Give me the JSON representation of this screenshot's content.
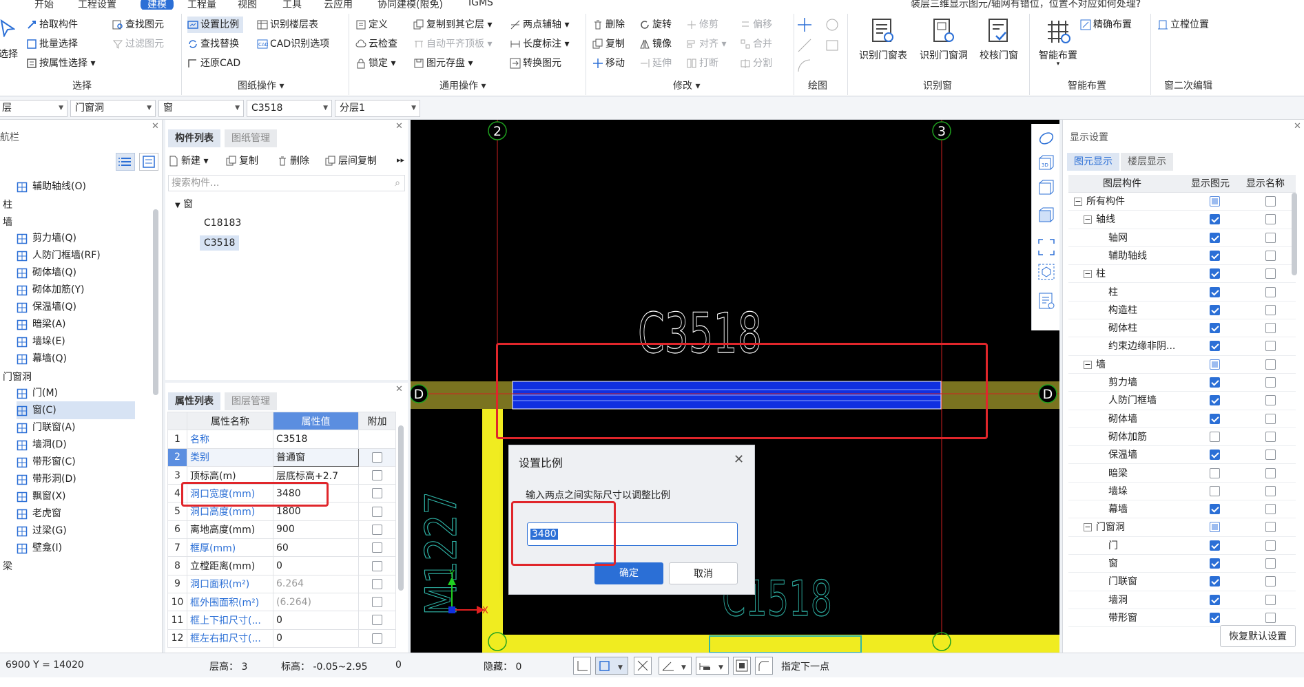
{
  "menu": {
    "items": [
      "开始",
      "工程设置",
      "建模",
      "工程量",
      "视图",
      "工具",
      "云应用",
      "协同建模(限免)",
      "IGMS"
    ],
    "active_index": 2,
    "hint": "装层三维显示图元/轴网有错位，位置不对应如何处理?"
  },
  "ribbon": {
    "select_group": {
      "big": "选择",
      "items": [
        "拾取构件",
        "批量选择",
        "按属性选择",
        "查找图元",
        "过滤图元"
      ],
      "title": "选择"
    },
    "drawing_ops": {
      "items": [
        "设置比例",
        "识别楼层表",
        "查找替换",
        "CAD识别选项",
        "还原CAD"
      ],
      "title": "图纸操作"
    },
    "common_ops": {
      "items": [
        "定义",
        "复制到其它层",
        "两点辅轴",
        "云检查",
        "自动平齐顶板",
        "长度标注",
        "锁定",
        "图元存盘",
        "转换图元"
      ],
      "title": "通用操作"
    },
    "modify": {
      "items": [
        "删除",
        "旋转",
        "修剪",
        "偏移",
        "复制",
        "镜像",
        "对齐",
        "合并",
        "移动",
        "延伸",
        "打断",
        "分割"
      ],
      "title": "修改"
    },
    "draw": {
      "title": "绘图"
    },
    "recognize": {
      "items": [
        "识别门窗表",
        "识别门窗洞",
        "校核门窗"
      ],
      "title": "识别窗"
    },
    "smart": {
      "items": [
        "智能布置",
        "精确布置"
      ],
      "title": "智能布置"
    },
    "window_edit": {
      "items": [
        "立樘位置"
      ],
      "title": "窗二次编辑"
    }
  },
  "selectors": [
    "层",
    "门窗洞",
    "窗",
    "C3518",
    "分层1"
  ],
  "nav": {
    "title": "航栏",
    "items": [
      {
        "type": "item",
        "label": "辅助轴线(O)",
        "icon": "grid-icon"
      },
      {
        "type": "cat",
        "label": "柱"
      },
      {
        "type": "cat",
        "label": "墙"
      },
      {
        "type": "item",
        "label": "剪力墙(Q)",
        "icon": "wall-icon"
      },
      {
        "type": "item",
        "label": "人防门框墙(RF)",
        "icon": "wall-icon"
      },
      {
        "type": "item",
        "label": "砌体墙(Q)",
        "icon": "brick-icon"
      },
      {
        "type": "item",
        "label": "砌体加筋(Y)",
        "icon": "rebar-icon"
      },
      {
        "type": "item",
        "label": "保温墙(Q)",
        "icon": "insulation-icon"
      },
      {
        "type": "item",
        "label": "暗梁(A)",
        "icon": "beam-icon"
      },
      {
        "type": "item",
        "label": "墙垛(E)",
        "icon": "pier-icon"
      },
      {
        "type": "item",
        "label": "幕墙(Q)",
        "icon": "curtain-icon"
      },
      {
        "type": "cat",
        "label": "门窗洞"
      },
      {
        "type": "item",
        "label": "门(M)",
        "icon": "door-icon"
      },
      {
        "type": "item",
        "label": "窗(C)",
        "icon": "window-icon",
        "selected": true
      },
      {
        "type": "item",
        "label": "门联窗(A)",
        "icon": "door-window-icon"
      },
      {
        "type": "item",
        "label": "墙洞(D)",
        "icon": "hole-icon"
      },
      {
        "type": "item",
        "label": "带形窗(C)",
        "icon": "strip-window-icon"
      },
      {
        "type": "item",
        "label": "带形洞(D)",
        "icon": "strip-hole-icon"
      },
      {
        "type": "item",
        "label": "飘窗(X)",
        "icon": "bay-window-icon"
      },
      {
        "type": "item",
        "label": "老虎窗",
        "icon": "dormer-icon"
      },
      {
        "type": "item",
        "label": "过梁(G)",
        "icon": "lintel-icon"
      },
      {
        "type": "item",
        "label": "壁龛(I)",
        "icon": "niche-icon"
      },
      {
        "type": "cat",
        "label": "梁"
      }
    ]
  },
  "components": {
    "tabs": [
      "构件列表",
      "图纸管理"
    ],
    "toolbar": [
      "新建",
      "复制",
      "删除",
      "层间复制"
    ],
    "search_placeholder": "搜索构件...",
    "group": "窗",
    "list": [
      "C18183",
      "C3518"
    ],
    "selected": "C3518"
  },
  "properties": {
    "tabs": [
      "属性列表",
      "图层管理"
    ],
    "headers": [
      "属性名称",
      "属性值",
      "附加"
    ],
    "rows": [
      {
        "n": "1",
        "name": "名称",
        "value": "C3518",
        "blue": true,
        "cb": false,
        "hascb": false
      },
      {
        "n": "2",
        "name": "类别",
        "value": "普通窗",
        "blue": true,
        "cb": false,
        "hascb": true
      },
      {
        "n": "3",
        "name": "顶标高(m)",
        "value": "层底标高+2.7",
        "blue": false,
        "cb": false,
        "hascb": true
      },
      {
        "n": "4",
        "name": "洞口宽度(mm)",
        "value": "3480",
        "blue": true,
        "cb": false,
        "hascb": true
      },
      {
        "n": "5",
        "name": "洞口高度(mm)",
        "value": "1800",
        "blue": true,
        "cb": false,
        "hascb": true
      },
      {
        "n": "6",
        "name": "离地高度(mm)",
        "value": "900",
        "blue": false,
        "cb": false,
        "hascb": true
      },
      {
        "n": "7",
        "name": "框厚(mm)",
        "value": "60",
        "blue": true,
        "cb": false,
        "hascb": true
      },
      {
        "n": "8",
        "name": "立樘距离(mm)",
        "value": "0",
        "blue": false,
        "cb": false,
        "hascb": true
      },
      {
        "n": "9",
        "name": "洞口面积(m²)",
        "value": "6.264",
        "blue": true,
        "cb": false,
        "hascb": true
      },
      {
        "n": "10",
        "name": "框外围面积(m²)",
        "value": "(6.264)",
        "blue": true,
        "cb": false,
        "hascb": true
      },
      {
        "n": "11",
        "name": "框上下扣尺寸(...",
        "value": "0",
        "blue": true,
        "cb": false,
        "hascb": true
      },
      {
        "n": "12",
        "name": "框左右扣尺寸(...",
        "value": "0",
        "blue": true,
        "cb": false,
        "hascb": true
      }
    ]
  },
  "canvas": {
    "axis_labels": [
      "2",
      "3",
      "D",
      "D"
    ],
    "texts": [
      "C3518",
      "M1227",
      "C1518"
    ],
    "axis_x": "X",
    "axis_y": "Y"
  },
  "dialog": {
    "title": "设置比例",
    "prompt": "输入两点之间实际尺寸以调整比例",
    "value": "3480",
    "ok": "确定",
    "cancel": "取消"
  },
  "display": {
    "title": "显示设置",
    "tabs": [
      "图元显示",
      "楼层显示"
    ],
    "headers": [
      "图层构件",
      "显示图元",
      "显示名称"
    ],
    "rows": [
      {
        "level": 0,
        "toggle": "-",
        "label": "所有构件",
        "show": "part",
        "name": "off"
      },
      {
        "level": 1,
        "toggle": "-",
        "label": "轴线",
        "show": "on",
        "name": "off"
      },
      {
        "level": 2,
        "toggle": "",
        "label": "轴网",
        "show": "on",
        "name": "off"
      },
      {
        "level": 2,
        "toggle": "",
        "label": "辅助轴线",
        "show": "on",
        "name": "off"
      },
      {
        "level": 1,
        "toggle": "-",
        "label": "柱",
        "show": "on",
        "name": "off"
      },
      {
        "level": 2,
        "toggle": "",
        "label": "柱",
        "show": "on",
        "name": "off"
      },
      {
        "level": 2,
        "toggle": "",
        "label": "构造柱",
        "show": "on",
        "name": "off"
      },
      {
        "level": 2,
        "toggle": "",
        "label": "砌体柱",
        "show": "on",
        "name": "off"
      },
      {
        "level": 2,
        "toggle": "",
        "label": "约束边缘非阴...",
        "show": "on",
        "name": "off"
      },
      {
        "level": 1,
        "toggle": "-",
        "label": "墙",
        "show": "part",
        "name": "off"
      },
      {
        "level": 2,
        "toggle": "",
        "label": "剪力墙",
        "show": "on",
        "name": "off"
      },
      {
        "level": 2,
        "toggle": "",
        "label": "人防门框墙",
        "show": "on",
        "name": "off"
      },
      {
        "level": 2,
        "toggle": "",
        "label": "砌体墙",
        "show": "on",
        "name": "off"
      },
      {
        "level": 2,
        "toggle": "",
        "label": "砌体加筋",
        "show": "off",
        "name": "off"
      },
      {
        "level": 2,
        "toggle": "",
        "label": "保温墙",
        "show": "on",
        "name": "off"
      },
      {
        "level": 2,
        "toggle": "",
        "label": "暗梁",
        "show": "off",
        "name": "off"
      },
      {
        "level": 2,
        "toggle": "",
        "label": "墙垛",
        "show": "off",
        "name": "off"
      },
      {
        "level": 2,
        "toggle": "",
        "label": "幕墙",
        "show": "on",
        "name": "off"
      },
      {
        "level": 1,
        "toggle": "-",
        "label": "门窗洞",
        "show": "part",
        "name": "off"
      },
      {
        "level": 2,
        "toggle": "",
        "label": "门",
        "show": "on",
        "name": "off"
      },
      {
        "level": 2,
        "toggle": "",
        "label": "窗",
        "show": "on",
        "name": "off"
      },
      {
        "level": 2,
        "toggle": "",
        "label": "门联窗",
        "show": "on",
        "name": "off"
      },
      {
        "level": 2,
        "toggle": "",
        "label": "墙洞",
        "show": "on",
        "name": "off"
      },
      {
        "level": 2,
        "toggle": "",
        "label": "带形窗",
        "show": "on",
        "name": "off"
      }
    ],
    "reset": "恢复默认设置"
  },
  "status": {
    "coords": "6900 Y = 14020",
    "floor_height": "层高：  3",
    "elevation": "标高：  -0.05~2.95",
    "zero": "0",
    "hidden": "隐藏：  0",
    "prompt": "指定下一点"
  },
  "colors": {
    "accent": "#2b6fd6",
    "highlight": "#e0262b",
    "wall": "#7a7320",
    "window": "#1030e0",
    "yellow": "#f0ec20"
  }
}
